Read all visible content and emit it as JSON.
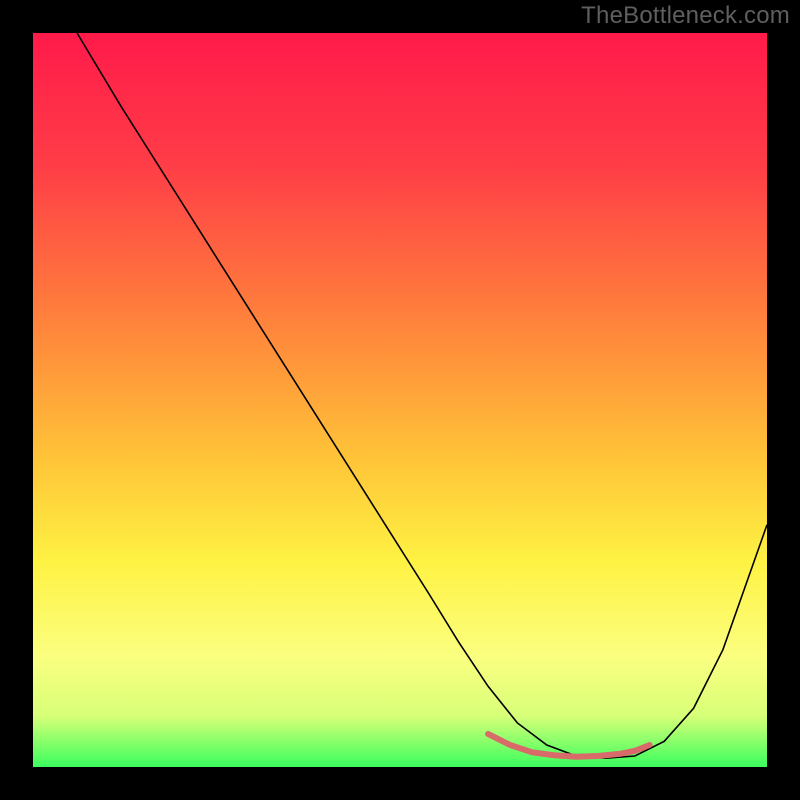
{
  "watermark": "TheBottleneck.com",
  "chart_data": {
    "type": "line",
    "title": "",
    "xlabel": "",
    "ylabel": "",
    "xlim": [
      0,
      100
    ],
    "ylim": [
      0,
      100
    ],
    "grid": false,
    "background": {
      "stops": [
        {
          "offset": 0,
          "color": "#ff1a4a"
        },
        {
          "offset": 18,
          "color": "#ff3d47"
        },
        {
          "offset": 38,
          "color": "#ff7e3c"
        },
        {
          "offset": 58,
          "color": "#ffc438"
        },
        {
          "offset": 72,
          "color": "#fef243"
        },
        {
          "offset": 85,
          "color": "#fbff80"
        },
        {
          "offset": 93,
          "color": "#d8ff78"
        },
        {
          "offset": 100,
          "color": "#3bff5e"
        }
      ]
    },
    "series": [
      {
        "name": "bottleneck-curve",
        "stroke": "#000000",
        "stroke_width": 1.6,
        "x": [
          6,
          12,
          18,
          24,
          30,
          36,
          42,
          48,
          54,
          58,
          62,
          66,
          70,
          74,
          78,
          82,
          86,
          90,
          94,
          100
        ],
        "y": [
          100,
          90,
          80.5,
          71,
          61.5,
          52,
          42.5,
          33,
          23.5,
          17,
          11,
          6,
          3,
          1.5,
          1.2,
          1.5,
          3.5,
          8,
          16,
          33
        ]
      },
      {
        "name": "optimal-range-marker",
        "stroke": "#d86a6a",
        "stroke_width": 6,
        "x": [
          62,
          65,
          68,
          71,
          74,
          77,
          80,
          82,
          84
        ],
        "y": [
          4.5,
          3.0,
          2.0,
          1.6,
          1.4,
          1.5,
          1.8,
          2.2,
          3.0
        ]
      }
    ]
  }
}
